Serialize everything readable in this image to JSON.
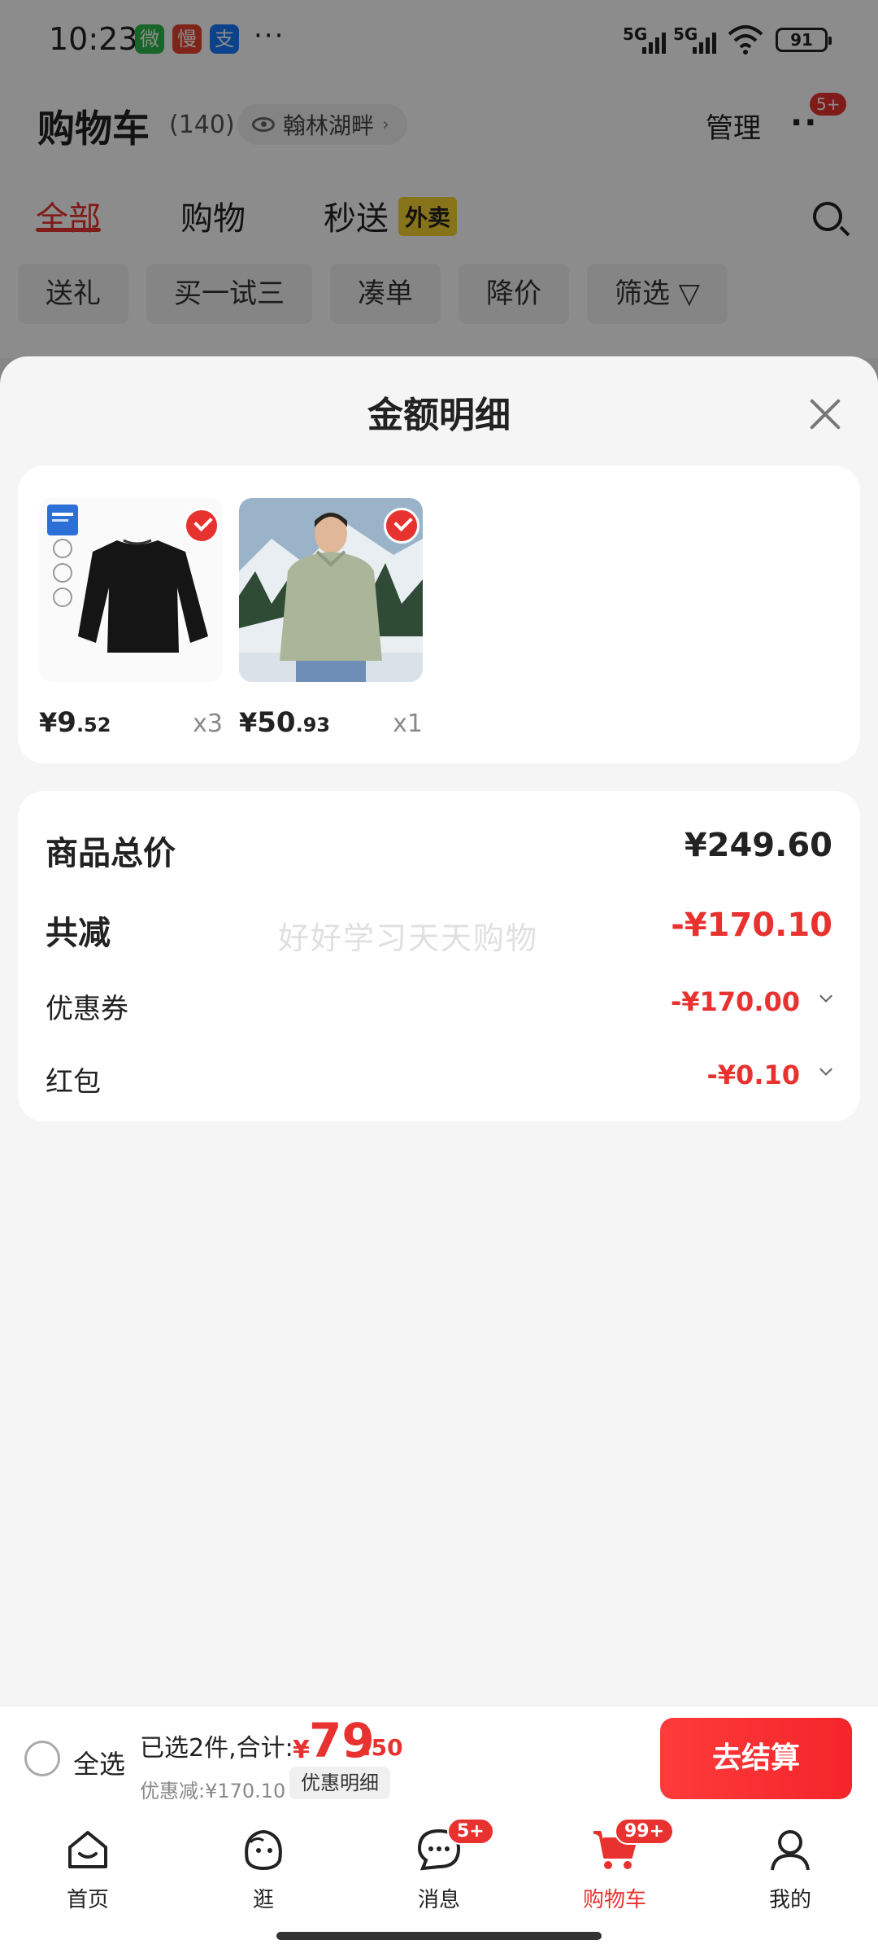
{
  "status_bar": {
    "time": "10:23",
    "apps": [
      "微",
      "慢",
      "支"
    ],
    "more": "···",
    "sig1": "5G",
    "sig2": "5G",
    "battery": "91"
  },
  "header": {
    "title": "购物车",
    "count": "(140)",
    "location": "翰林湖畔",
    "manage": "管理",
    "badge": "5+"
  },
  "tabs": [
    {
      "label": "全部",
      "active": true
    },
    {
      "label": "购物",
      "active": false
    },
    {
      "label": "秒送",
      "active": false,
      "tag": "外卖"
    }
  ],
  "filters": [
    "送礼",
    "买一试三",
    "凑单",
    "降价",
    "筛选 ▽"
  ],
  "sheet": {
    "title": "金额明细",
    "products": [
      {
        "price_sym": "¥",
        "price_int": "9",
        "price_dec": ".52",
        "qty": "x3"
      },
      {
        "price_sym": "¥",
        "price_int": "50",
        "price_dec": ".93",
        "qty": "x1"
      }
    ],
    "summary": {
      "total_label": "商品总价",
      "total_value": "¥249.60",
      "reduce_label": "共减",
      "reduce_value": "-¥170.10",
      "coupon_label": "优惠券",
      "coupon_value": "-¥170.00",
      "redpack_label": "红包",
      "redpack_value": "-¥0.10",
      "watermark": "好好学习天天购物"
    }
  },
  "checkout": {
    "select_all": "全选",
    "selected_info": "已选2件,合计:",
    "total_sym": "¥",
    "total_int": "79",
    "total_dec": ".50",
    "discount_info": "优惠减:¥170.10",
    "detail_button": "优惠明细",
    "checkout_button": "去结算"
  },
  "nav": [
    {
      "label": "首页",
      "icon": "home-icon"
    },
    {
      "label": "逛",
      "icon": "browse-icon"
    },
    {
      "label": "消息",
      "icon": "message-icon",
      "badge": "5+"
    },
    {
      "label": "购物车",
      "icon": "cart-icon",
      "badge": "99+",
      "active": true
    },
    {
      "label": "我的",
      "icon": "profile-icon"
    }
  ],
  "colors": {
    "accent": "#e8322f",
    "tag_yellow": "#f6d22e"
  }
}
